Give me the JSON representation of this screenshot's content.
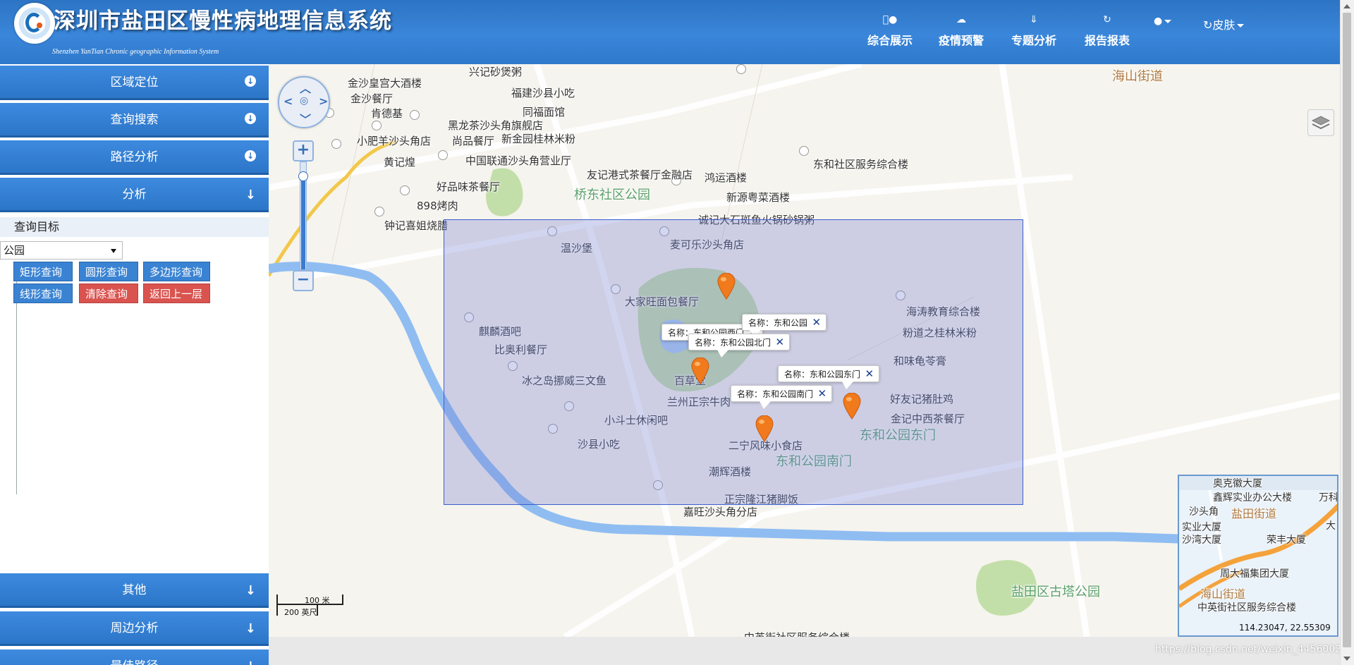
{
  "header": {
    "title": "深圳市盐田区慢性病地理信息系统",
    "subtitle": "Shenzhen YanTian Chronic geographic Information System",
    "nav": [
      {
        "icon": "apple-icon",
        "label": "综合展示"
      },
      {
        "icon": "cloud-icon",
        "label": "疫情预警"
      },
      {
        "icon": "download-circle-icon",
        "label": "专题分析"
      },
      {
        "icon": "refresh-icon",
        "label": "报告报表"
      }
    ],
    "extra_icon": "apple-icon",
    "skin_label": "皮肤"
  },
  "sidebar": {
    "sections": [
      {
        "label": "区域定位",
        "icon": "circle-arrow-down-icon"
      },
      {
        "label": "查询搜索",
        "icon": "circle-arrow-down-icon"
      },
      {
        "label": "路径分析",
        "icon": "circle-arrow-down-icon"
      },
      {
        "label": "分析",
        "icon": "arrow-down-icon"
      }
    ],
    "query_target_label": "查询目标",
    "target_select_value": "公园",
    "buttons": {
      "rect": "矩形查询",
      "circle": "圆形查询",
      "polygon": "多边形查询",
      "line": "线形查询",
      "clear": "清除查询",
      "back": "返回上一层"
    },
    "bottom_sections": [
      {
        "label": "其他",
        "icon": "arrow-down-icon"
      },
      {
        "label": "周边分析",
        "icon": "arrow-down-icon"
      },
      {
        "label": "最佳路径",
        "icon": "arrow-down-icon"
      }
    ]
  },
  "map": {
    "pois": [
      "兴记砂煲粥",
      "金沙皇宫大酒楼",
      "金沙餐厅",
      "肯德基",
      "福建沙县小吃",
      "同福面馆",
      "黑龙茶沙头角旗舰店",
      "小肥羊沙头角店",
      "尚品餐厅",
      "新金园桂林米粉",
      "黄记煌",
      "中国联通沙头角营业厅",
      "友记港式茶餐厅金融店",
      "鸿运酒楼",
      "好品味茶餐厅",
      "新源粤菜酒楼",
      "898烤肉",
      "诚记大石斑鱼火锅砂锅粥",
      "钟记喜姐烧腊",
      "温沙堡",
      "麦可乐沙头角店",
      "大家旺面包餐厅",
      "海涛教育综合楼",
      "麒麟酒吧",
      "粉道之桂林米粉",
      "比奥利餐厅",
      "和味龟苓膏",
      "冰之岛挪威三文鱼",
      "百草堂",
      "兰州正宗牛肉",
      "好友记猪肚鸡",
      "小斗士休闲吧",
      "金记中西茶餐厅",
      "沙县小吃",
      "二宁风味小食店",
      "潮辉酒楼",
      "正宗隆江猪脚饭",
      "嘉旺沙头角分店",
      "东和社区服务综合楼",
      "中英街社区服务综合楼"
    ],
    "parks": [
      "桥东社区公园",
      "东和公园东门",
      "东和公园南门",
      "盐田区古塔公园"
    ],
    "district_labels": [
      "海山街道"
    ],
    "popups": [
      {
        "label": "名称：东和公园西门"
      },
      {
        "label": "名称：东和公园"
      },
      {
        "label": "名称：东和公园北门"
      },
      {
        "label": "名称：东和公园东门"
      },
      {
        "label": "名称：东和公园南门"
      }
    ],
    "scale": {
      "metric": "100 米",
      "imperial": "200 英尺"
    },
    "overview_labels": [
      "奥克徽大厦",
      "鑫辉实业办公大楼",
      "沙头角",
      "盐田街道",
      "实业大厦",
      "沙湾大厦",
      "荣丰大厦",
      "周大福集团大厦",
      "海山街道",
      "中英街社区服务综合楼",
      "万科",
      "大"
    ],
    "coordinates": "114.23047, 22.55309",
    "colors": {
      "selection": "#3a5fcf",
      "marker": "#f07a1c",
      "header": "#3a86da"
    }
  },
  "watermark": "https://blog.csdn.net/weixin_44560027"
}
